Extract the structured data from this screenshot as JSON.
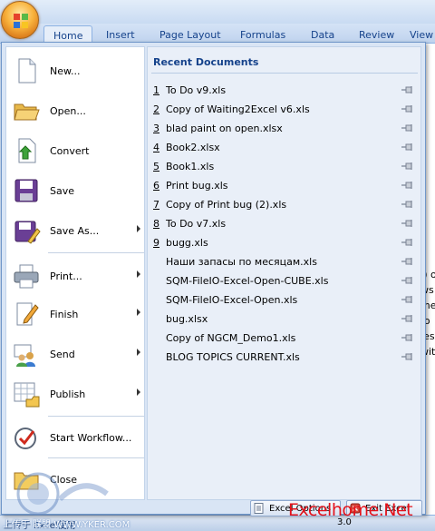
{
  "ribbon": {
    "tabs": [
      "Home",
      "Insert",
      "Page Layout",
      "Formulas",
      "Data",
      "Review",
      "View"
    ]
  },
  "background_sheet": {
    "edge_texts": [
      "I) o",
      "ws",
      "me",
      "fo",
      "les",
      "with"
    ],
    "status_text": "上传于 Excel使用",
    "cell_value": "3.0"
  },
  "menu": {
    "commands": [
      {
        "label": "New...",
        "icon": "new-document-icon",
        "submenu": false
      },
      {
        "label": "Open...",
        "icon": "open-folder-icon",
        "submenu": false
      },
      {
        "label": "Convert",
        "icon": "convert-icon",
        "submenu": false
      },
      {
        "label": "Save",
        "icon": "save-disk-icon",
        "submenu": false
      },
      {
        "label": "Save As...",
        "icon": "save-as-icon",
        "submenu": true
      },
      {
        "label": "Print...",
        "icon": "printer-icon",
        "submenu": true
      },
      {
        "label": "Finish",
        "icon": "finish-pen-icon",
        "submenu": true
      },
      {
        "label": "Send",
        "icon": "send-people-icon",
        "submenu": true
      },
      {
        "label": "Publish",
        "icon": "publish-icon",
        "submenu": true
      },
      {
        "label": "Start Workflow...",
        "icon": "workflow-icon",
        "submenu": false
      },
      {
        "label": "Close",
        "icon": "close-folder-icon",
        "submenu": false
      }
    ],
    "recent_header": "Recent Documents",
    "recent_documents": [
      {
        "num": "1",
        "name": "To Do v9.xls"
      },
      {
        "num": "2",
        "name": "Copy of Waiting2Excel v6.xls"
      },
      {
        "num": "3",
        "name": "blad paint on open.xlsx"
      },
      {
        "num": "4",
        "name": "Book2.xlsx"
      },
      {
        "num": "5",
        "name": "Book1.xls"
      },
      {
        "num": "6",
        "name": "Print bug.xls"
      },
      {
        "num": "7",
        "name": "Copy of Print bug (2).xls"
      },
      {
        "num": "8",
        "name": "To Do v7.xls"
      },
      {
        "num": "9",
        "name": "bugg.xls"
      },
      {
        "num": "",
        "name": "Наши запасы по месяцам.xls"
      },
      {
        "num": "",
        "name": "SQM-FileIO-Excel-Open-CUBE.xls"
      },
      {
        "num": "",
        "name": "SQM-FileIO-Excel-Open.xls"
      },
      {
        "num": "",
        "name": "bug.xlsx"
      },
      {
        "num": "",
        "name": "Copy of NGCM_Demo1.xls"
      },
      {
        "num": "",
        "name": "BLOG TOPICS CURRENT.xls"
      }
    ],
    "bottom_buttons": {
      "options_label": "Excel Options",
      "exit_label": "Exit Excel"
    }
  },
  "watermark": {
    "right_text": "Excelhome.Net",
    "left_text": "上传于 联盟 WWW.YKER.COM"
  },
  "colors": {
    "accent": "#15428b",
    "menu_frame": "#d9e5f5",
    "watermark_red": "#e4121a"
  }
}
